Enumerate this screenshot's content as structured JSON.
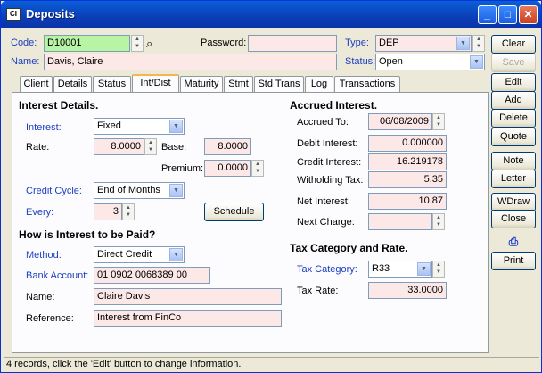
{
  "window": {
    "title": "Deposits",
    "icon": "app-icon"
  },
  "header": {
    "code_label": "Code:",
    "code_value": "D10001",
    "password_label": "Password:",
    "password_value": "",
    "type_label": "Type:",
    "type_value": "DEP",
    "name_label": "Name:",
    "name_value": "Davis, Claire",
    "status_label": "Status:",
    "status_value": "Open"
  },
  "tabs": [
    "Client",
    "Details",
    "Status",
    "Int/Dist",
    "Maturity",
    "Stmt",
    "Std Trans",
    "Log",
    "Transactions"
  ],
  "active_tab": "Int/Dist",
  "interest": {
    "title": "Interest Details.",
    "interest_label": "Interest:",
    "interest_value": "Fixed",
    "rate_label": "Rate:",
    "rate_value": "8.0000",
    "base_label": "Base:",
    "base_value": "8.0000",
    "premium_label": "Premium:",
    "premium_value": "0.0000",
    "credit_cycle_label": "Credit Cycle:",
    "credit_cycle_value": "End of Months",
    "every_label": "Every:",
    "every_value": "3",
    "schedule_button": "Schedule"
  },
  "payment": {
    "title": "How is Interest to be Paid?",
    "method_label": "Method:",
    "method_value": "Direct Credit",
    "bank_label": "Bank Account:",
    "bank_value": "01 0902 0068389 00",
    "name_label": "Name:",
    "name_value": "Claire Davis",
    "reference_label": "Reference:",
    "reference_value": "Interest from FinCo"
  },
  "accrued": {
    "title": "Accrued Interest.",
    "accrued_to_label": "Accrued To:",
    "accrued_to_value": "06/08/2009",
    "debit_label": "Debit Interest:",
    "debit_value": "0.000000",
    "credit_label": "Credit Interest:",
    "credit_value": "16.219178",
    "withholding_label": "Witholding Tax:",
    "withholding_value": "5.35",
    "net_label": "Net Interest:",
    "net_value": "10.87",
    "next_charge_label": "Next Charge:",
    "next_charge_value": ""
  },
  "tax": {
    "title": "Tax Category and Rate.",
    "category_label": "Tax Category:",
    "category_value": "R33",
    "rate_label": "Tax Rate:",
    "rate_value": "33.0000"
  },
  "sidebar": {
    "clear": "Clear",
    "save": "Save",
    "edit": "Edit",
    "add": "Add",
    "delete": "Delete",
    "quote": "Quote",
    "note": "Note",
    "letter": "Letter",
    "wdraw": "WDraw",
    "close": "Close",
    "print": "Print"
  },
  "status_bar": "4 records, click the 'Edit' button to change information."
}
